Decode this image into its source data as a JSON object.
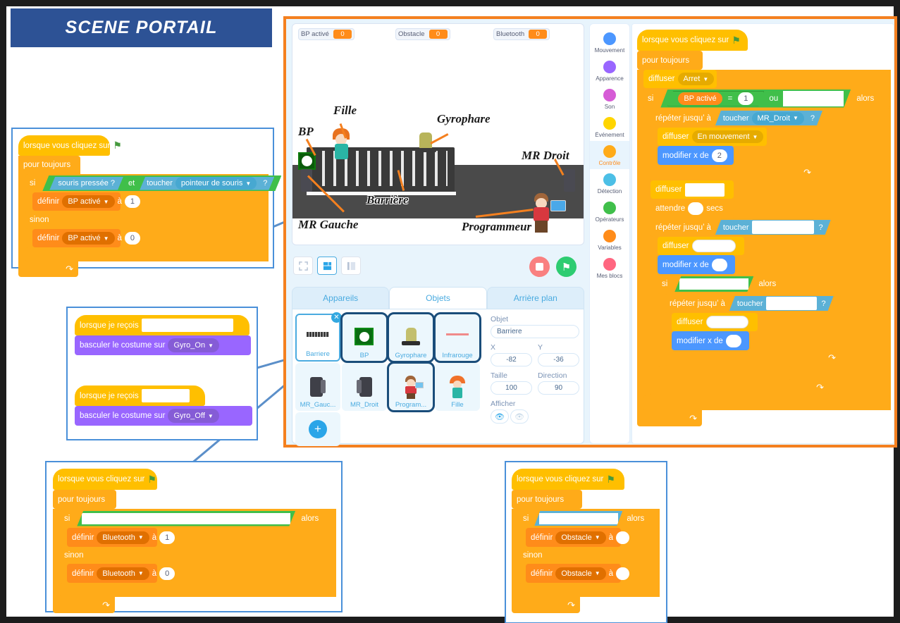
{
  "title": "SCENE PORTAIL",
  "app": {
    "stage": {
      "monitors": [
        {
          "name": "BP activé",
          "value": "0"
        },
        {
          "name": "Obstacle",
          "value": "0"
        },
        {
          "name": "Bluetooth",
          "value": "0"
        }
      ],
      "annotations": [
        "Fille",
        "BP",
        "Gyrophare",
        "MR Droit",
        "Barrière",
        "MR Gauche",
        "Programmeur"
      ],
      "controls": {
        "stop": "stop-icon",
        "go": "green-flag-icon"
      }
    },
    "tabs": [
      {
        "label": "Appareils",
        "active": false
      },
      {
        "label": "Objets",
        "active": true
      },
      {
        "label": "Arrière plan",
        "active": false
      }
    ],
    "sprites": [
      {
        "name": "Barriere",
        "selected": true
      },
      {
        "name": "BP",
        "selected": false
      },
      {
        "name": "Gyrophare",
        "selected": false
      },
      {
        "name": "Infrarouge",
        "selected": false
      },
      {
        "name": "MR_Gauc...",
        "selected": false
      },
      {
        "name": "MR_Droit",
        "selected": false
      },
      {
        "name": "Program...",
        "selected": false
      },
      {
        "name": "Fille",
        "selected": false
      }
    ],
    "add_sprite_label": "Ajouter",
    "object_info": {
      "objet_label": "Objet",
      "objet_value": "Barriere",
      "x_label": "X",
      "x_value": "-82",
      "y_label": "Y",
      "y_value": "-36",
      "taille_label": "Taille",
      "taille_value": "100",
      "direction_label": "Direction",
      "direction_value": "90",
      "afficher_label": "Afficher"
    },
    "categories": [
      {
        "label": "Mouvement",
        "color": "#4c97ff",
        "active": false
      },
      {
        "label": "Apparence",
        "color": "#9966ff",
        "active": false
      },
      {
        "label": "Son",
        "color": "#d65cd6",
        "active": false
      },
      {
        "label": "Événement",
        "color": "#ffd500",
        "active": false
      },
      {
        "label": "Contrôle",
        "color": "#ffab19",
        "active": true
      },
      {
        "label": "Détection",
        "color": "#4cbfe6",
        "active": false
      },
      {
        "label": "Opérateurs",
        "color": "#40bf4a",
        "active": false
      },
      {
        "label": "Variables",
        "color": "#ff8c1a",
        "active": false
      },
      {
        "label": "Mes blocs",
        "color": "#ff6680",
        "active": false
      }
    ]
  },
  "scripts": {
    "bp": {
      "hat": "lorsque vous cliquez sur",
      "forever": "pour toujours",
      "si": "si",
      "alors": "alors",
      "sinon": "sinon",
      "cond_a": "souris pressée ?",
      "et": "et",
      "toucher": "toucher",
      "cond_b_target": "pointeur de souris",
      "qmark": "?",
      "definir": "définir",
      "var": "BP activé",
      "a": "à",
      "val_true": "1",
      "val_false": "0"
    },
    "gyro": {
      "recois_1": "lorsque je reçois",
      "recois_1_msg": "",
      "costume_1": "basculer le costume sur",
      "costume_1_val": "Gyro_On",
      "recois_2": "lorsque je reçois",
      "recois_2_msg": "",
      "costume_2": "basculer le costume sur",
      "costume_2_val": "Gyro_Off"
    },
    "bluetooth": {
      "hat": "lorsque vous cliquez sur",
      "forever": "pour toujours",
      "si": "si",
      "alors": "alors",
      "sinon": "sinon",
      "definir": "définir",
      "var": "Bluetooth",
      "a": "à",
      "val_true": "1",
      "val_false": "0"
    },
    "obstacle": {
      "hat": "lorsque vous cliquez sur",
      "forever": "pour toujours",
      "si": "si",
      "alors": "alors",
      "sinon": "sinon",
      "definir": "définir",
      "var": "Obstacle",
      "a": "à",
      "val_true": "",
      "val_false": ""
    },
    "barriere": {
      "hat": "lorsque vous cliquez sur",
      "forever": "pour toujours",
      "diffuser": "diffuser",
      "diffuser_arret": "Arret",
      "si": "si",
      "alors": "alors",
      "var_bp": "BP activé",
      "eq": "=",
      "eq_val": "1",
      "ou": "ou",
      "repeter": "répéter jusqu’ à",
      "toucher": "toucher",
      "touch_mr_droit": "MR_Droit",
      "qmark": "?",
      "diffuser_mouv": "En mouvement",
      "modifier_x": "modifier x de",
      "modifier_x_val": "2",
      "attendre": "attendre",
      "secs": "secs",
      "attendre_val": "",
      "diffuser_blank": "",
      "toucher_blank": "",
      "modifier_x_blank": ""
    }
  }
}
